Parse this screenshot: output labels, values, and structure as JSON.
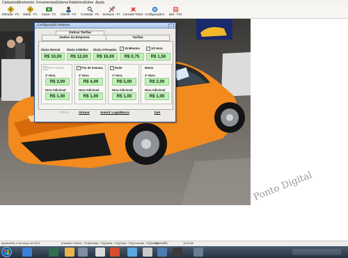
{
  "menu": [
    "Cadastros",
    "Movimento",
    "Ferramentas",
    "Sistema",
    "Relatórios",
    "Sobre",
    "Ajuda"
  ],
  "toolbar": [
    {
      "label": "Entrada - F3",
      "icon": "arrow-in-icon"
    },
    {
      "label": "Saída - F4",
      "icon": "arrow-out-icon"
    },
    {
      "label": "Caixa - F2",
      "icon": "cash-icon"
    },
    {
      "label": "Cliente - F2",
      "icon": "person-icon"
    },
    {
      "label": "Consulta - F6",
      "icon": "magnifier-icon"
    },
    {
      "label": "Serviços - F7",
      "icon": "tools-icon"
    },
    {
      "label": "Cancela Ticket",
      "icon": "cancel-icon"
    },
    {
      "label": "Configurações",
      "icon": "gear-icon"
    },
    {
      "label": "Sair - F12",
      "icon": "exit-icon"
    }
  ],
  "watermark": "Ponto Digital",
  "dialog": {
    "title": "Configuração Sistema",
    "close": "x",
    "tab_outras": "Outras Tarifas",
    "tab_dados": "Dados da Empresa",
    "tab_tarifas": "Tarifas",
    "top": [
      {
        "label": "Diaria Normal",
        "value": "R$ 10,00"
      },
      {
        "label": "Diaria V.Médios",
        "value": "R$ 12,00"
      },
      {
        "label": "Diaria V.Pesados",
        "value": "R$ 16,00"
      },
      {
        "label": "15 Minutos",
        "value": "R$ 0,75",
        "checked": true
      },
      {
        "label": "1/2 Hora",
        "value": "R$ 1,50",
        "checked": true
      }
    ],
    "groups": [
      {
        "title": "Mês Feriado",
        "checked": true,
        "disabled": true,
        "first_label": "1º Hora",
        "first_value": "R$ 3,00",
        "add_label": "Hora Adicional",
        "add_value": "R$ 1,00"
      },
      {
        "title": "Fim de Semana",
        "checked": true,
        "disabled": false,
        "first_label": "1º Hora",
        "first_value": "R$ 4,00",
        "add_label": "Hora Adicional",
        "add_value": "R$ 1,00"
      },
      {
        "title": "Noite",
        "checked": true,
        "disabled": false,
        "first_label": "1º Hora",
        "first_value": "R$ 5,00",
        "add_label": "Hora Adicional",
        "add_value": "R$ 1,00"
      },
      {
        "title": "Motos",
        "checked": false,
        "disabled": false,
        "first_label": "1º Hora",
        "first_value": "R$ 2,00",
        "add_label": "Hora Adicional",
        "add_value": "R$ 1,00"
      }
    ],
    "buttons": {
      "alterar": "Alterar",
      "gravar": "Gravar",
      "logo": "Inserir LogoMarca",
      "sair": "Sair"
    }
  },
  "status": {
    "date": "quarta-feira, 8 de março de 2012",
    "shortcuts": "(Cadastro Cliente - F2)(Entrada - F3)(Saída - F4)(Caixa - F5)(Consulta - F6)(Serviços - F7)",
    "mode": "INS",
    "num": "IVO",
    "time": "10:10:58"
  },
  "colors": {
    "accent": "#2d5aa0",
    "value_bg": "#bff2b6",
    "car": "#f28a1e"
  }
}
